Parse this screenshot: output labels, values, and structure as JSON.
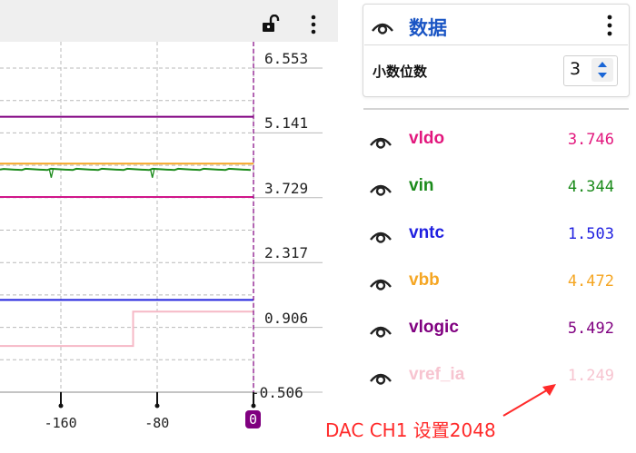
{
  "toolbar": {
    "lock_icon": "lock-open-icon",
    "more_icon": "more-vert-icon"
  },
  "chart_data": {
    "type": "line",
    "y_ticks": [
      "6.553",
      "5.141",
      "3.729",
      "2.317",
      "0.906",
      "-0.506"
    ],
    "x_ticks": [
      "-160",
      "-80",
      "0"
    ],
    "ylim": [
      -0.506,
      6.553
    ],
    "grid": true,
    "series": [
      {
        "name": "vlogic",
        "color": "#800080",
        "values": [
          5.492,
          5.492
        ]
      },
      {
        "name": "vbb",
        "color": "#f5a623",
        "values": [
          4.472,
          4.472
        ]
      },
      {
        "name": "vin",
        "color": "#1a8a1a",
        "values": [
          4.344,
          4.344
        ]
      },
      {
        "name": "vldo",
        "color": "#d0168a",
        "values": [
          3.746,
          3.746
        ]
      },
      {
        "name": "vntc",
        "color": "#2222dd",
        "values": [
          1.503,
          1.503
        ]
      },
      {
        "name": "vref_ia",
        "color": "#f6b8c6",
        "values": [
          0.5,
          1.249
        ]
      }
    ]
  },
  "panel": {
    "title": "数据",
    "decimals_label": "小数位数",
    "decimals_value": "3",
    "more_icon": "more-vert-icon",
    "eye_icon": "eye-icon"
  },
  "signals": [
    {
      "name": "vldo",
      "value": "3.746",
      "color": "#e2177d"
    },
    {
      "name": "vin",
      "value": "4.344",
      "color": "#1a8a1a"
    },
    {
      "name": "vntc",
      "value": "1.503",
      "color": "#1f1fe0"
    },
    {
      "name": "vbb",
      "value": "4.472",
      "color": "#f5a623"
    },
    {
      "name": "vlogic",
      "value": "5.492",
      "color": "#800080"
    },
    {
      "name": "vref_ia",
      "value": "1.249",
      "color": "#f7c4d0"
    }
  ],
  "annotation": {
    "text": "DAC CH1 设置2048",
    "color": "#ff2a2a"
  }
}
